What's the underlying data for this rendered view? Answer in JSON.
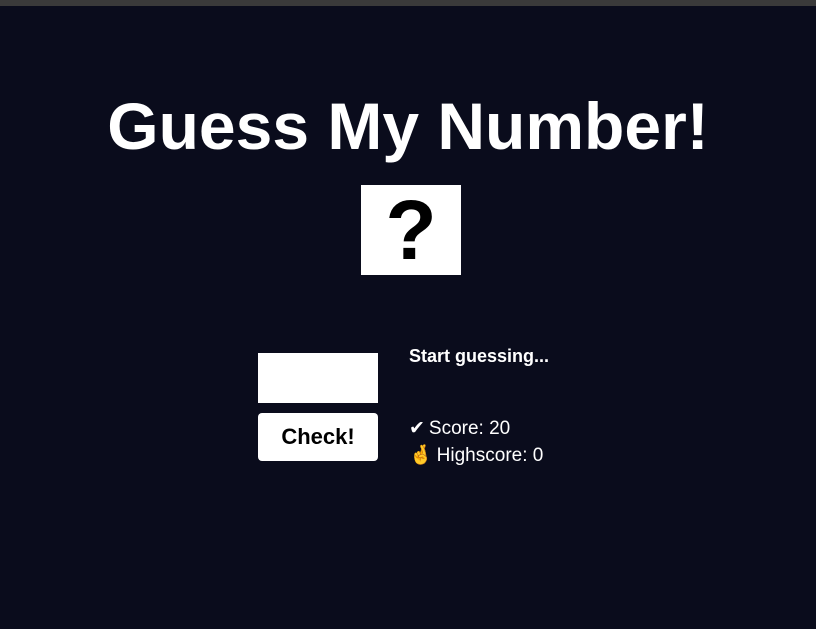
{
  "header": {
    "title": "Guess My Number!"
  },
  "secret": {
    "display": "?"
  },
  "controls": {
    "guess_value": "",
    "check_label": "Check!"
  },
  "status": {
    "message": "Start guessing...",
    "score_icon": "✔",
    "score_label": "Score: 20",
    "highscore_icon": "🤞",
    "highscore_label": "Highscore: 0"
  }
}
